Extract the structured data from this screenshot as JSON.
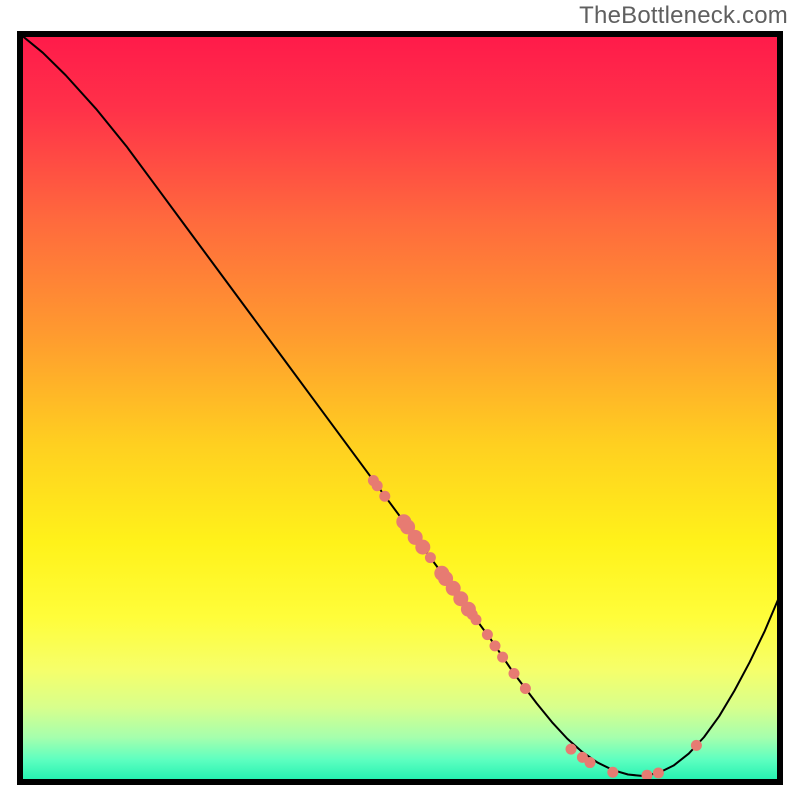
{
  "watermark": "TheBottleneck.com",
  "chart_data": {
    "type": "line",
    "title": "",
    "xlabel": "",
    "ylabel": "",
    "xlim": [
      0,
      100
    ],
    "ylim": [
      0,
      100
    ],
    "grid": false,
    "legend": false,
    "series": [
      {
        "name": "curve",
        "x": [
          0,
          3,
          6,
          10,
          14,
          18,
          22,
          26,
          30,
          34,
          38,
          42,
          46,
          50,
          54,
          58,
          62,
          65,
          68,
          70,
          72,
          74,
          76,
          78,
          80,
          82,
          84,
          86,
          88,
          90,
          92,
          94,
          96,
          98,
          100
        ],
        "y": [
          100,
          97.5,
          94.5,
          90,
          85,
          79.5,
          74,
          68.5,
          63,
          57.5,
          52,
          46.5,
          41,
          35.5,
          30,
          24.5,
          19,
          14.5,
          10.5,
          8,
          5.8,
          4,
          2.6,
          1.6,
          1,
          0.8,
          1.2,
          2.2,
          3.8,
          6,
          8.8,
          12.2,
          16,
          20.2,
          25
        ],
        "stroke": "#000000",
        "stroke_width": 2
      }
    ],
    "markers": [
      {
        "x": 46.5,
        "y": 40.3,
        "r": 5.5
      },
      {
        "x": 47.0,
        "y": 39.6,
        "r": 5.5
      },
      {
        "x": 48.0,
        "y": 38.2,
        "r": 5.5
      },
      {
        "x": 50.5,
        "y": 34.8,
        "r": 7.5
      },
      {
        "x": 51.0,
        "y": 34.1,
        "r": 7.5
      },
      {
        "x": 52.0,
        "y": 32.7,
        "r": 7.5
      },
      {
        "x": 53.0,
        "y": 31.4,
        "r": 7.5
      },
      {
        "x": 54.0,
        "y": 30.0,
        "r": 5.5
      },
      {
        "x": 55.5,
        "y": 27.9,
        "r": 7.5
      },
      {
        "x": 56.0,
        "y": 27.2,
        "r": 7.5
      },
      {
        "x": 57.0,
        "y": 25.9,
        "r": 7.5
      },
      {
        "x": 58.0,
        "y": 24.5,
        "r": 7.5
      },
      {
        "x": 59.0,
        "y": 23.1,
        "r": 7.5
      },
      {
        "x": 59.5,
        "y": 22.4,
        "r": 5.5
      },
      {
        "x": 60.0,
        "y": 21.7,
        "r": 5.5
      },
      {
        "x": 61.5,
        "y": 19.7,
        "r": 5.5
      },
      {
        "x": 62.5,
        "y": 18.2,
        "r": 5.5
      },
      {
        "x": 63.5,
        "y": 16.7,
        "r": 5.5
      },
      {
        "x": 65.0,
        "y": 14.5,
        "r": 5.5
      },
      {
        "x": 66.5,
        "y": 12.5,
        "r": 5.5
      },
      {
        "x": 72.5,
        "y": 4.4,
        "r": 5.5
      },
      {
        "x": 74.0,
        "y": 3.3,
        "r": 5.5
      },
      {
        "x": 75.0,
        "y": 2.6,
        "r": 5.5
      },
      {
        "x": 78.0,
        "y": 1.3,
        "r": 5.5
      },
      {
        "x": 82.5,
        "y": 0.9,
        "r": 5.5
      },
      {
        "x": 84.0,
        "y": 1.2,
        "r": 5.5
      },
      {
        "x": 89.0,
        "y": 4.9,
        "r": 5.5
      }
    ],
    "marker_color": "#e77b72",
    "gradient_stops": [
      {
        "offset": 0.0,
        "color": "#ff1a4a"
      },
      {
        "offset": 0.1,
        "color": "#ff3149"
      },
      {
        "offset": 0.25,
        "color": "#ff6a3d"
      },
      {
        "offset": 0.4,
        "color": "#ff9a2f"
      },
      {
        "offset": 0.55,
        "color": "#ffd020"
      },
      {
        "offset": 0.68,
        "color": "#fff21a"
      },
      {
        "offset": 0.78,
        "color": "#fffd3a"
      },
      {
        "offset": 0.85,
        "color": "#f6ff6a"
      },
      {
        "offset": 0.9,
        "color": "#d8ff8c"
      },
      {
        "offset": 0.94,
        "color": "#a6ffad"
      },
      {
        "offset": 0.97,
        "color": "#5effc0"
      },
      {
        "offset": 1.0,
        "color": "#1ef0b0"
      }
    ]
  }
}
